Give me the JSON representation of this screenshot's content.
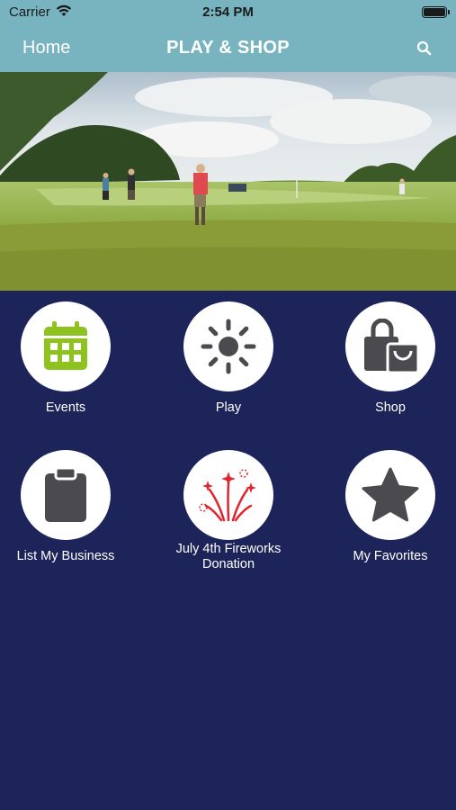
{
  "status_bar": {
    "carrier": "Carrier",
    "time": "2:54 PM",
    "icons": [
      "wifi-icon",
      "battery-icon"
    ]
  },
  "nav": {
    "back_label": "Home",
    "title": "PLAY & SHOP",
    "search_icon": "search-icon"
  },
  "hero": {
    "image": "golf-course-photo"
  },
  "tiles": [
    {
      "label": "Events",
      "icon": "calendar-icon",
      "color": "#8dc21f"
    },
    {
      "label": "Play",
      "icon": "sun-icon",
      "color": "#4a4a4f"
    },
    {
      "label": "Shop",
      "icon": "shopping-bag-icon",
      "color": "#4a4a4f"
    },
    {
      "label": "List My Business",
      "icon": "clipboard-icon",
      "color": "#4a4a4f"
    },
    {
      "label": "July 4th Fireworks Donation",
      "icon": "fireworks-icon",
      "color": "#e0252f"
    },
    {
      "label": "My Favorites",
      "icon": "star-icon",
      "color": "#4a4a4f"
    }
  ],
  "colors": {
    "header": "#78b3c0",
    "background": "#1c2459",
    "icon_dark": "#4a4a4f",
    "accent_green": "#8dc21f",
    "accent_red": "#e0252f"
  }
}
